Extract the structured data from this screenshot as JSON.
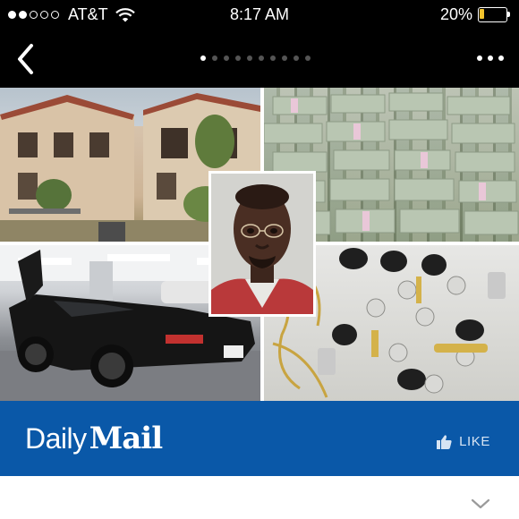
{
  "status_bar": {
    "signal_bars_filled": 2,
    "signal_bars_total": 5,
    "carrier": "AT&T",
    "time": "8:17 AM",
    "battery_text": "20%",
    "battery_level": 0.2,
    "battery_color": "#f3c32c"
  },
  "nav": {
    "back_icon": "chevron-left-icon",
    "page_count": 10,
    "active_page_index": 0,
    "more_icon": "ellipsis-icon"
  },
  "collage": {
    "photos": [
      "house-photo",
      "money-stacks-photo",
      "sports-car-photo",
      "watches-jewelry-photo",
      "mugshot-photo"
    ]
  },
  "ad": {
    "logo_part1": "Daily",
    "logo_part2": "Mail",
    "like_label": "LIKE",
    "like_icon": "thumbs-up-icon",
    "background_color": "#0a58a8"
  },
  "footer": {
    "expand_icon": "chevron-down-icon"
  }
}
